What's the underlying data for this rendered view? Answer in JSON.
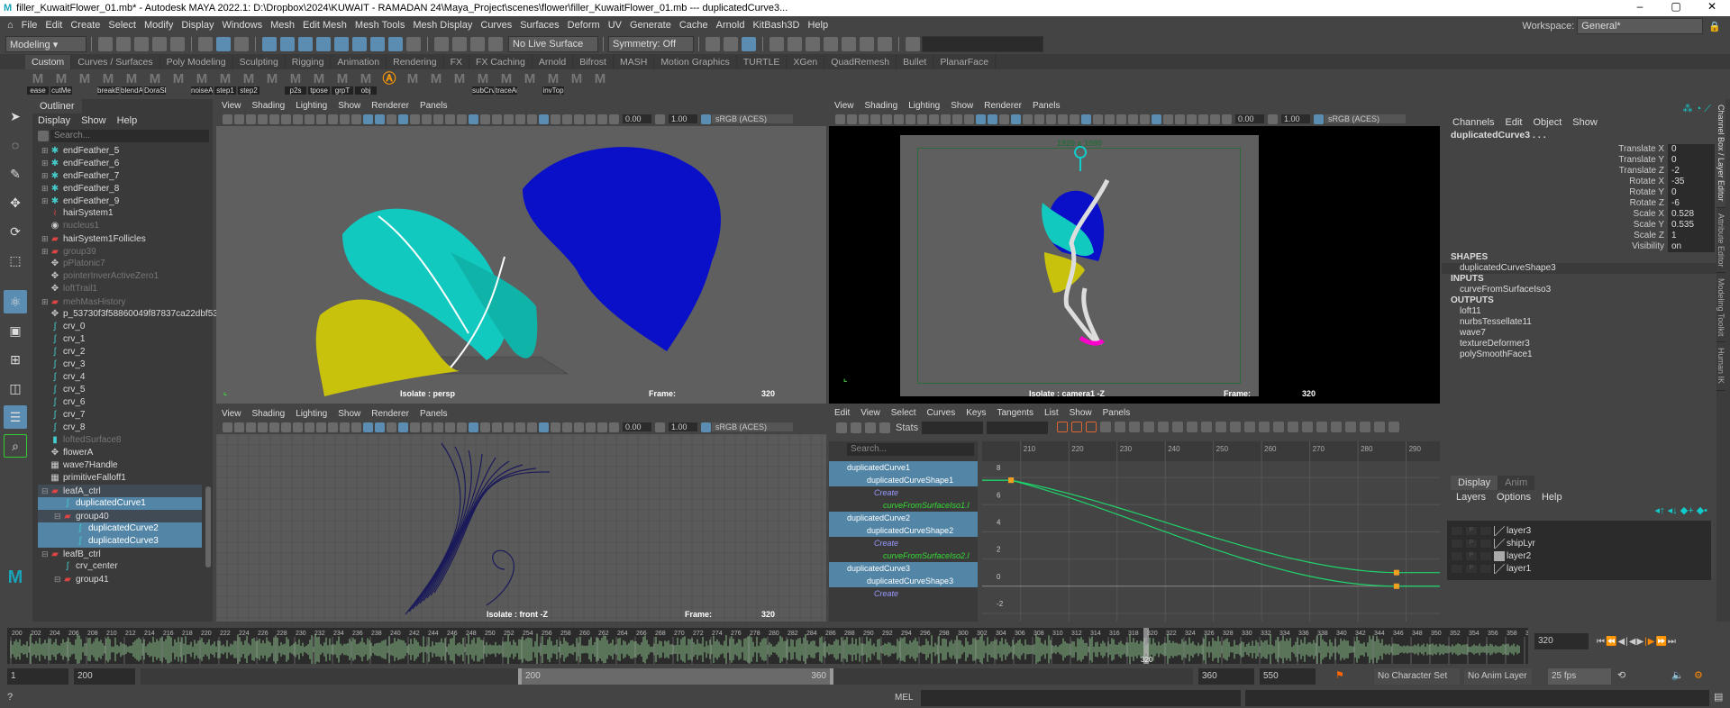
{
  "title": "filler_KuwaitFlower_01.mb* - Autodesk MAYA 2022.1: D:\\Dropbox\\2024\\KUWAIT - RAMADAN 24\\Maya_Project\\scenes\\flower\\filler_KuwaitFlower_01.mb  ---  duplicatedCurve3...",
  "window_controls": [
    "–",
    "▢",
    "✕"
  ],
  "menus": [
    "File",
    "Edit",
    "Create",
    "Select",
    "Modify",
    "Display",
    "Windows",
    "Mesh",
    "Edit Mesh",
    "Mesh Tools",
    "Mesh Display",
    "Curves",
    "Surfaces",
    "Deform",
    "UV",
    "Generate",
    "Cache",
    "Arnold",
    "KitBash3D",
    "Help"
  ],
  "status": {
    "menuset": "Modeling",
    "live_surface": "No Live Surface",
    "symmetry": "Symmetry: Off",
    "workspace_label": "Workspace:",
    "workspace": "General*"
  },
  "shelf_tabs": [
    "Custom",
    "Curves / Surfaces",
    "Poly Modeling",
    "Sculpting",
    "Rigging",
    "Animation",
    "Rendering",
    "FX",
    "FX Caching",
    "Arnold",
    "Bifrost",
    "MASH",
    "Motion Graphics",
    "TURTLE",
    "XGen",
    "QuadRemesh",
    "Bullet",
    "PlanarFace"
  ],
  "shelf_active": "Custom",
  "shelf_buttons": [
    "ease",
    "cutMe",
    "",
    "breakB",
    "blendA",
    "DoraSk",
    "",
    "noiseAt",
    "step1",
    "step2",
    "",
    "p2s",
    "tpose",
    "grpT",
    "obj",
    "A",
    "",
    "",
    "",
    "subCrv",
    "traceAr",
    "",
    "invTop",
    "",
    ""
  ],
  "outliner": {
    "tab": "Outliner",
    "menu": [
      "Display",
      "Show",
      "Help"
    ],
    "search_placeholder": "Search...",
    "items": [
      {
        "name": "endFeather_5",
        "icon": "particle-icon",
        "exp": "+",
        "dim": false,
        "indent": 0
      },
      {
        "name": "endFeather_6",
        "icon": "particle-icon",
        "exp": "+",
        "dim": false,
        "indent": 0
      },
      {
        "name": "endFeather_7",
        "icon": "particle-icon",
        "exp": "+",
        "dim": false,
        "indent": 0
      },
      {
        "name": "endFeather_8",
        "icon": "particle-icon",
        "exp": "+",
        "dim": false,
        "indent": 0
      },
      {
        "name": "endFeather_9",
        "icon": "particle-icon",
        "exp": "+",
        "dim": false,
        "indent": 0
      },
      {
        "name": "hairSystem1",
        "icon": "hair-icon",
        "exp": "",
        "dim": false,
        "indent": 0
      },
      {
        "name": "nucleus1",
        "icon": "nucleus-icon",
        "exp": "",
        "dim": true,
        "indent": 0
      },
      {
        "name": "hairSystem1Follicles",
        "icon": "group-icon",
        "exp": "+",
        "dim": false,
        "indent": 0
      },
      {
        "name": "group39",
        "icon": "group-icon",
        "exp": "+",
        "dim": true,
        "indent": 0
      },
      {
        "name": "pPlatonic7",
        "icon": "transform-icon",
        "exp": "",
        "dim": true,
        "indent": 0
      },
      {
        "name": "pointerInverActiveZero1",
        "icon": "transform-icon",
        "exp": "",
        "dim": true,
        "indent": 0
      },
      {
        "name": "loftTrail1",
        "icon": "transform-icon",
        "exp": "",
        "dim": true,
        "indent": 0
      },
      {
        "name": "mehMasHistory",
        "icon": "group-icon",
        "exp": "+",
        "dim": true,
        "indent": 0
      },
      {
        "name": "p_53730f3f58860049f87837ca22dbf535",
        "icon": "transform-icon",
        "exp": "",
        "dim": false,
        "indent": 0
      },
      {
        "name": "crv_0",
        "icon": "curve-icon",
        "exp": "",
        "dim": false,
        "indent": 0
      },
      {
        "name": "crv_1",
        "icon": "curve-icon",
        "exp": "",
        "dim": false,
        "indent": 0
      },
      {
        "name": "crv_2",
        "icon": "curve-icon",
        "exp": "",
        "dim": false,
        "indent": 0
      },
      {
        "name": "crv_3",
        "icon": "curve-icon",
        "exp": "",
        "dim": false,
        "indent": 0
      },
      {
        "name": "crv_4",
        "icon": "curve-icon",
        "exp": "",
        "dim": false,
        "indent": 0
      },
      {
        "name": "crv_5",
        "icon": "curve-icon",
        "exp": "",
        "dim": false,
        "indent": 0
      },
      {
        "name": "crv_6",
        "icon": "curve-icon",
        "exp": "",
        "dim": false,
        "indent": 0
      },
      {
        "name": "crv_7",
        "icon": "curve-icon",
        "exp": "",
        "dim": false,
        "indent": 0
      },
      {
        "name": "crv_8",
        "icon": "curve-icon",
        "exp": "",
        "dim": false,
        "indent": 0
      },
      {
        "name": "loftedSurface8",
        "icon": "surface-icon",
        "exp": "",
        "dim": true,
        "indent": 0
      },
      {
        "name": "flowerA",
        "icon": "transform-icon",
        "exp": "",
        "dim": false,
        "indent": 0
      },
      {
        "name": "wave7Handle",
        "icon": "deformer-icon",
        "exp": "",
        "dim": false,
        "indent": 0
      },
      {
        "name": "primitiveFalloff1",
        "icon": "deformer-icon",
        "exp": "",
        "dim": false,
        "indent": 0
      },
      {
        "name": "leafA_ctrl",
        "icon": "group-icon",
        "exp": "−",
        "dim": false,
        "indent": 0,
        "state": "par"
      },
      {
        "name": "duplicatedCurve1",
        "icon": "curve-icon",
        "exp": "",
        "dim": false,
        "indent": 1,
        "state": "sel"
      },
      {
        "name": "group40",
        "icon": "group-icon",
        "exp": "−",
        "dim": false,
        "indent": 1,
        "state": "par"
      },
      {
        "name": "duplicatedCurve2",
        "icon": "curve-icon",
        "exp": "",
        "dim": false,
        "indent": 2,
        "state": "sel"
      },
      {
        "name": "duplicatedCurve3",
        "icon": "curve-icon",
        "exp": "",
        "dim": false,
        "indent": 2,
        "state": "sel"
      },
      {
        "name": "leafB_ctrl",
        "icon": "group-icon",
        "exp": "−",
        "dim": false,
        "indent": 0
      },
      {
        "name": "crv_center",
        "icon": "curve-icon",
        "exp": "",
        "dim": false,
        "indent": 1
      },
      {
        "name": "group41",
        "icon": "group-icon",
        "exp": "−",
        "dim": false,
        "indent": 1
      }
    ]
  },
  "viewport_menu": [
    "View",
    "Shading",
    "Lighting",
    "Show",
    "Renderer",
    "Panels"
  ],
  "viewport_tools": {
    "exposure": "0.00",
    "gamma": "1.00",
    "colorspace": "sRGB (ACES)"
  },
  "viewports": {
    "persp": {
      "isolate": "Isolate : persp",
      "frame_label": "Frame:",
      "frame": "320"
    },
    "camera": {
      "resolution": "1920 x 1080",
      "isolate": "Isolate : camera1 -Z",
      "frame_label": "Frame:",
      "frame": "320"
    },
    "front": {
      "isolate": "Isolate : front -Z",
      "frame_label": "Frame:",
      "frame": "320"
    }
  },
  "channel_box": {
    "menu": [
      "Channels",
      "Edit",
      "Object",
      "Show"
    ],
    "object": "duplicatedCurve3 . . .",
    "channels": [
      {
        "label": "Translate X",
        "value": "0"
      },
      {
        "label": "Translate Y",
        "value": "0"
      },
      {
        "label": "Translate Z",
        "value": "-2"
      },
      {
        "label": "Rotate X",
        "value": "-35"
      },
      {
        "label": "Rotate Y",
        "value": "0"
      },
      {
        "label": "Rotate Z",
        "value": "-6"
      },
      {
        "label": "Scale X",
        "value": "0.528"
      },
      {
        "label": "Scale Y",
        "value": "0.535"
      },
      {
        "label": "Scale Z",
        "value": "1"
      },
      {
        "label": "Visibility",
        "value": "on"
      }
    ],
    "shapes_label": "SHAPES",
    "shapes": [
      "duplicatedCurveShape3"
    ],
    "inputs_label": "INPUTS",
    "inputs": [
      "curveFromSurfaceIso3"
    ],
    "outputs_label": "OUTPUTS",
    "outputs": [
      "loft11",
      "nurbsTessellate11",
      "wave7",
      "textureDeformer3",
      "polySmoothFace1"
    ]
  },
  "side_tabs": [
    "Channel Box / Layer Editor",
    "Attribute Editor",
    "Modeling Toolkit",
    "Human IK"
  ],
  "layer_editor": {
    "tabs": [
      "Display",
      "Anim"
    ],
    "menu": [
      "Layers",
      "Options",
      "Help"
    ],
    "layers": [
      {
        "name": "layer3",
        "p": "P"
      },
      {
        "name": "shipLyr",
        "p": "P"
      },
      {
        "name": "layer2",
        "p": "P"
      },
      {
        "name": "layer1",
        "p": "P"
      }
    ]
  },
  "graph_editor": {
    "menu": [
      "Edit",
      "View",
      "Select",
      "Curves",
      "Keys",
      "Tangents",
      "List",
      "Show",
      "Panels"
    ],
    "stats_label": "Stats",
    "search_placeholder": "Search...",
    "outline": [
      {
        "text": "duplicatedCurve1",
        "type": "node",
        "sel": true
      },
      {
        "text": "duplicatedCurveShape1",
        "type": "shape",
        "sel": true
      },
      {
        "text": "Create",
        "type": "create",
        "sel": false
      },
      {
        "text": "curveFromSurfaceIso1.l",
        "type": "conn",
        "sel": false
      },
      {
        "text": "duplicatedCurve2",
        "type": "node",
        "sel": true
      },
      {
        "text": "duplicatedCurveShape2",
        "type": "shape",
        "sel": true
      },
      {
        "text": "Create",
        "type": "create",
        "sel": false
      },
      {
        "text": "curveFromSurfaceIso2.l",
        "type": "conn",
        "sel": false
      },
      {
        "text": "duplicatedCurve3",
        "type": "node",
        "sel": true
      },
      {
        "text": "duplicatedCurveShape3",
        "type": "shape",
        "sel": true
      },
      {
        "text": "Create",
        "type": "create",
        "sel": false
      }
    ]
  },
  "chart_data": {
    "type": "line",
    "x_ticks": [
      210,
      220,
      230,
      240,
      250,
      260,
      270,
      280,
      290
    ],
    "y_ticks": [
      8,
      6,
      4,
      2,
      0,
      -2
    ],
    "xlim": [
      202,
      297
    ],
    "ylim": [
      -2.6,
      9.2
    ],
    "grid": true,
    "series": [
      {
        "keys": [
          [
            208,
            7.8
          ],
          [
            288,
            1.0
          ]
        ]
      },
      {
        "keys": [
          [
            208,
            7.8
          ],
          [
            288,
            0.0
          ]
        ]
      }
    ],
    "curve_color": "#1fd46a",
    "key_color": "#f0a020"
  },
  "timeline": {
    "start": 200,
    "end": 360,
    "step": 2,
    "current": "320",
    "current_field": "320"
  },
  "range": {
    "anim_start": "1",
    "play_start": "200",
    "slider_start": "200",
    "slider_end": "360",
    "play_end": "360",
    "anim_end": "550",
    "character_set": "No Character Set",
    "anim_layer": "No Anim Layer",
    "fps": "25 fps"
  },
  "command": {
    "lang": "MEL"
  },
  "colors": {
    "accent": "#5b8db2",
    "selected": "#5285a6",
    "bg": "#444444",
    "waveform": "#6a8c6a"
  }
}
